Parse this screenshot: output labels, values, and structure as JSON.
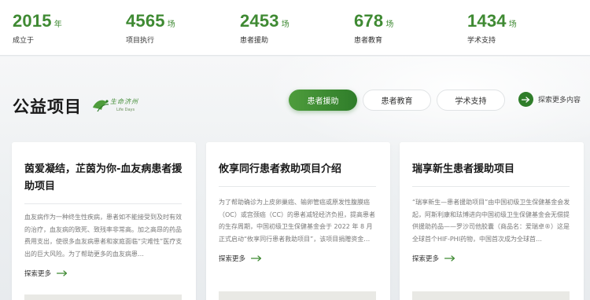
{
  "stats": [
    {
      "number": "2015",
      "unit": "年",
      "label": "成立于"
    },
    {
      "number": "4565",
      "unit": "场",
      "label": "项目执行"
    },
    {
      "number": "2453",
      "unit": "场",
      "label": "患者援助"
    },
    {
      "number": "678",
      "unit": "场",
      "label": "患者教育"
    },
    {
      "number": "1434",
      "unit": "场",
      "label": "学术支持"
    }
  ],
  "section": {
    "title": "公益项目",
    "logo_text": "生命济州",
    "logo_subtext": "Life Days"
  },
  "tabs": [
    {
      "label": "患者援助",
      "active": true
    },
    {
      "label": "患者教育",
      "active": false
    },
    {
      "label": "学术支持",
      "active": false
    }
  ],
  "explore_more_label": "探索更多内容",
  "cards": [
    {
      "title": "茵爱凝结，芷茵为你-血友病患者援助项目",
      "text": "血友病作为一种终生性疾病，患者如不能接受到及时有效的治疗，血友病的致死、致残率非常高。加之高昂的药品费用支出，使很多血友病患者和家庭面临“灾难性”医疗支出的巨大风险。为了帮助更多的血友病患…",
      "link_label": "探索更多"
    },
    {
      "title": "攸享同行患者救助项目介绍",
      "text": "为了帮助确诊为上皮卵巢癌、输卵管癌或原发性腹膜癌（OC）或宫颈癌（CC）的患者减轻经济负担，提高患者的生存周期，中国初级卫生保健基金会于 2022 年 8 月正式启动“攸享同行患者救助项目”，该项目捐赠资金…",
      "link_label": "探索更多"
    },
    {
      "title": "瑞享新生患者援助项目",
      "text": "“瑞享新生—患者援助项目”由中国初级卫生保健基金会发起，阿斯利康和珐博进向中国初级卫生保健基金会无偿提供援助药品——罗沙司他胶囊（商品名：爱瑞卓®）这是全球首个HIF-PHI药物，中国首次成为全球首…",
      "link_label": "探索更多"
    }
  ],
  "colors": {
    "accent": "#3f8a33",
    "accent_dark": "#2f7d2a"
  }
}
